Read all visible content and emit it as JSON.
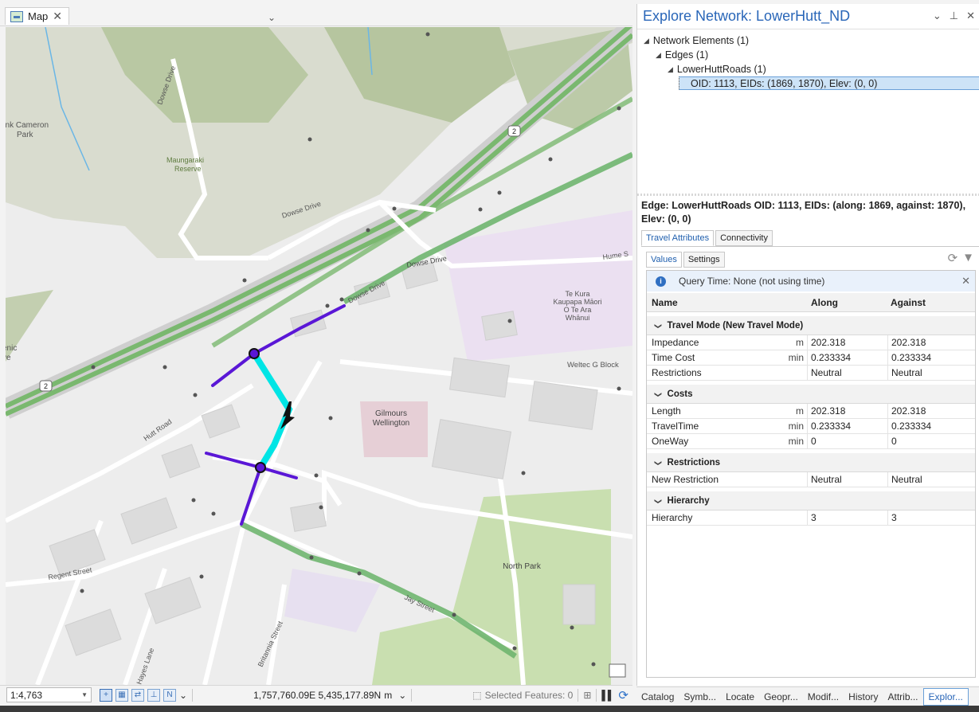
{
  "map_tab": {
    "label": "Map",
    "close": "✕",
    "overflow": "⌄"
  },
  "map_labels": {
    "dowse_drive_1": "Dowse Drive",
    "dowse_drive_2": "Dowse Drive",
    "dowse_drive_3": "Dowse Drive",
    "dowse_drive_4": "Dowse Drive",
    "park_1": "ank Cameron",
    "park_2": "Park",
    "maungaraki_1": "Maungaraki",
    "maungaraki_2": "Reserve",
    "hume": "Hume S",
    "te_kura_1": "Te Kura",
    "te_kura_2": "Kaupapa Māori",
    "te_kura_3": "O Te Ara",
    "te_kura_4": "Whānui",
    "weltec": "Weltec G Block",
    "gilmours_1": "Gilmours",
    "gilmours_2": "Wellington",
    "hutt_road": "Hutt Road",
    "enic_1": "enic",
    "enic_2": "ve",
    "north_park": "North Park",
    "regent": "Regent Street",
    "jay": "Jay Street",
    "britannia": "Britannia Street",
    "hayes": "Hayes Lane",
    "shield_2a": "2",
    "shield_2b": "2"
  },
  "status_bar": {
    "scale": "1:4,763",
    "coordinates": "1,757,760.09E 5,435,177.89N",
    "coord_unit": "m",
    "selected_features": "Selected Features: 0"
  },
  "panel": {
    "title": "Explore Network: LowerHutt_ND",
    "tree": {
      "network_elements": "Network Elements (1)",
      "edges": "Edges (1)",
      "source": "LowerHuttRoads (1)",
      "selected": "OID: 1113, EIDs: (1869, 1870), Elev: (0, 0)"
    },
    "edge_heading": "Edge: LowerHuttRoads OID: 1113, EIDs: (along: 1869, against: 1870), Elev: (0, 0)",
    "tabs_outer": [
      "Travel Attributes",
      "Connectivity"
    ],
    "tabs_inner": [
      "Values",
      "Settings"
    ],
    "info": "Query Time: None (not using time)",
    "columns": {
      "name": "Name",
      "along": "Along",
      "against": "Against"
    },
    "groups": [
      {
        "label": "Travel Mode (New Travel Mode)",
        "rows": [
          {
            "name": "Impedance",
            "unit": "m",
            "along": "202.318",
            "against": "202.318"
          },
          {
            "name": "Time Cost",
            "unit": "min",
            "along": "0.233334",
            "against": "0.233334"
          },
          {
            "name": "Restrictions",
            "unit": "",
            "along": "Neutral",
            "against": "Neutral"
          }
        ]
      },
      {
        "label": "Costs",
        "rows": [
          {
            "name": "Length",
            "unit": "m",
            "along": "202.318",
            "against": "202.318"
          },
          {
            "name": "TravelTime",
            "unit": "min",
            "along": "0.233334",
            "against": "0.233334"
          },
          {
            "name": "OneWay",
            "unit": "min",
            "along": "0",
            "against": "0"
          }
        ]
      },
      {
        "label": "Restrictions",
        "rows": [
          {
            "name": "New Restriction",
            "unit": "",
            "along": "Neutral",
            "against": "Neutral"
          }
        ]
      },
      {
        "label": "Hierarchy",
        "rows": [
          {
            "name": "Hierarchy",
            "unit": "",
            "along": "3",
            "against": "3"
          }
        ]
      }
    ]
  },
  "dock_tabs": [
    "Catalog",
    "Symb...",
    "Locate",
    "Geopr...",
    "Modif...",
    "History",
    "Attrib...",
    "Explor..."
  ],
  "colors": {
    "accent": "#2966b8",
    "edge_selected": "#00e5e5",
    "adjacent_edges": "#5a17d6",
    "route_green": "#6fb56f"
  }
}
